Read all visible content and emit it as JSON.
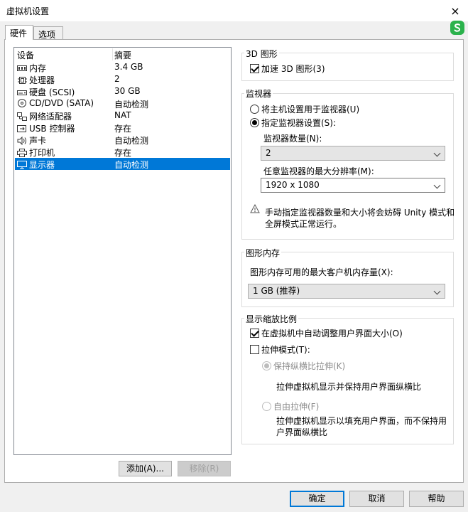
{
  "window": {
    "title": "虚拟机设置",
    "close_icon": "×"
  },
  "tabs": [
    {
      "label": "硬件"
    },
    {
      "label": "选项"
    }
  ],
  "device_list": {
    "headers": {
      "device": "设备",
      "summary": "摘要"
    },
    "items": [
      {
        "name": "内存",
        "summary": "3.4 GB",
        "icon": "memory-icon"
      },
      {
        "name": "处理器",
        "summary": "2",
        "icon": "cpu-icon"
      },
      {
        "name": "硬盘 (SCSI)",
        "summary": "30 GB",
        "icon": "hard-disk-icon"
      },
      {
        "name": "CD/DVD (SATA)",
        "summary": "自动检测",
        "icon": "cd-icon"
      },
      {
        "name": "网络适配器",
        "summary": "NAT",
        "icon": "network-icon"
      },
      {
        "name": "USB 控制器",
        "summary": "存在",
        "icon": "usb-icon"
      },
      {
        "name": "声卡",
        "summary": "自动检测",
        "icon": "speaker-icon"
      },
      {
        "name": "打印机",
        "summary": "存在",
        "icon": "printer-icon"
      },
      {
        "name": "显示器",
        "summary": "自动检测",
        "icon": "monitor-icon",
        "selected": true
      }
    ],
    "add_button": "添加(A)...",
    "remove_button": "移除(R)"
  },
  "graphics_3d": {
    "group_label": "3D 图形",
    "accelerate_label": "加速 3D 图形(3)",
    "accelerate_checked": true
  },
  "monitors": {
    "group_label": "监视器",
    "use_host_label": "将主机设置用于监视器(U)",
    "specify_label": "指定监视器设置(S):",
    "count_label": "监视器数量(N):",
    "count_value": "2",
    "max_res_label": "任意监视器的最大分辨率(M):",
    "max_res_value": "1920 x 1080",
    "warning_text_line1": "手动指定监视器数量和大小将会妨碍 Unity 模式和",
    "warning_text_line2": "全屏模式正常运行。"
  },
  "graphics_memory": {
    "group_label": "图形内存",
    "label": "图形内存可用的最大客户机内存量(X):",
    "value": "1 GB (推荐)"
  },
  "display_scaling": {
    "group_label": "显示缩放比例",
    "autofit_label": "在虚拟机中自动调整用户界面大小(O)",
    "autofit_checked": true,
    "stretch_label": "拉伸模式(T):",
    "stretch_checked": false,
    "keep_aspect_label": "保持纵横比拉伸(K)",
    "keep_aspect_desc": "拉伸虚拟机显示并保持用户界面纵横比",
    "free_stretch_label": "自由拉伸(F)",
    "free_stretch_desc_line1": "拉伸虚拟机显示以填充用户界面，而不保持用",
    "free_stretch_desc_line2": "户界面纵横比"
  },
  "footer": {
    "ok": "确定",
    "cancel": "取消",
    "help": "帮助"
  },
  "colors": {
    "selection": "#0078d7",
    "accent": "#0078d7",
    "tray_green": "#2bb24c"
  }
}
